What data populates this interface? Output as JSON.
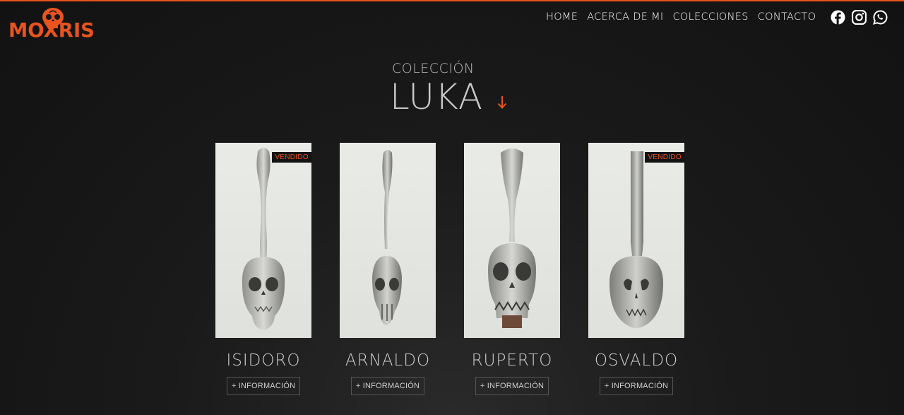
{
  "brand": {
    "logo_text": "MOXRIS",
    "accent": "#e8531f"
  },
  "nav": {
    "items": [
      {
        "label": "HOME"
      },
      {
        "label": "ACERCA DE MI"
      },
      {
        "label": "COLECCIONES"
      },
      {
        "label": "CONTACTO"
      }
    ]
  },
  "social": [
    "facebook-icon",
    "instagram-icon",
    "whatsapp-icon"
  ],
  "heading": {
    "sub": "COLECCIÓN",
    "main": "LUKA"
  },
  "products": [
    {
      "name": "ISIDORO",
      "badge": "VENDIDO",
      "button": "+ INFORMACIÓN"
    },
    {
      "name": "ARNALDO",
      "badge": "",
      "button": "+ INFORMACIÓN"
    },
    {
      "name": "RUPERTO",
      "badge": "",
      "button": "+ INFORMACIÓN"
    },
    {
      "name": "OSVALDO",
      "badge": "VENDIDO",
      "button": "+ INFORMACIÓN"
    }
  ]
}
